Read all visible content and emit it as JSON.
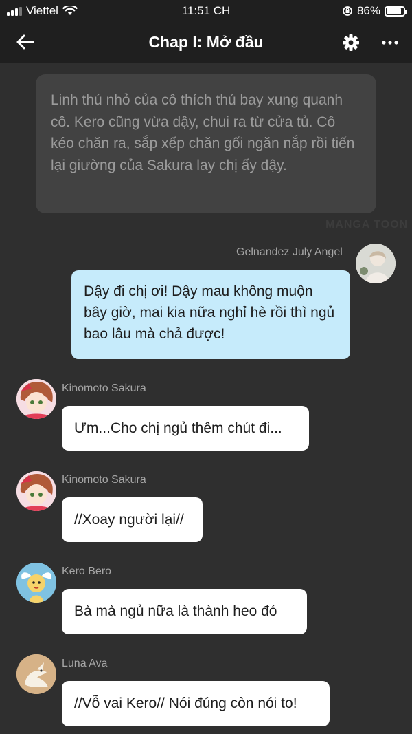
{
  "status": {
    "carrier": "Viettel",
    "time": "11:51 CH",
    "battery": "86%",
    "battery_level": 0.86
  },
  "header": {
    "title": "Chap I: Mở đầu",
    "back_icon": "arrow-left-icon",
    "settings_icon": "gear-icon",
    "more_icon": "more-dots-icon"
  },
  "narration": "Linh thú nhỏ của cô thích thú bay xung quanh cô. Kero cũng vừa dậy, chui ra từ cửa tủ. Cô kéo chăn ra, sắp xếp chăn gối ngăn nắp rồi tiến lại giường của Sakura lay chị ấy dậy.",
  "watermark": "MANGA TOON",
  "messages": [
    {
      "sender": "Gelnandez July Angel",
      "text": "Dậy đi chị ơi! Dậy mau không muộn bây giờ, mai kia nữa nghỉ hè rồi thì ngủ bao lâu mà chả được!"
    },
    {
      "sender": "Kinomoto Sakura",
      "text": "Ưm...Cho chị ngủ thêm chút đi..."
    },
    {
      "sender": "Kinomoto Sakura",
      "text": "//Xoay người lại//"
    },
    {
      "sender": "Kero Bero",
      "text": "Bà mà ngủ nữa là thành heo đó"
    },
    {
      "sender": "Luna Ava",
      "text": "//Vỗ vai Kero// Nói đúng còn nói to!"
    }
  ],
  "colors": {
    "background": "#2f2f2f",
    "header": "#1f1f1f",
    "narration_bg": "#424242",
    "own_bubble": "#c6ebfb",
    "other_bubble": "#ffffff"
  }
}
